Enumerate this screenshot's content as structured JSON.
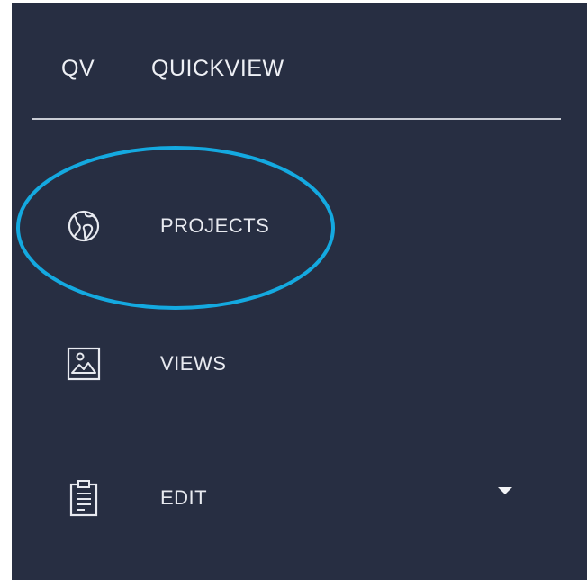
{
  "brand": {
    "short": "QV",
    "name": "QUICKVIEW"
  },
  "nav": {
    "items": [
      {
        "label": "PROJECTS",
        "icon": "globe-icon"
      },
      {
        "label": "VIEWS",
        "icon": "image-icon"
      },
      {
        "label": "EDIT",
        "icon": "clipboard-icon"
      }
    ]
  },
  "colors": {
    "background": "#272e42",
    "text": "#e8eaf0",
    "highlight": "#14a9e0"
  }
}
